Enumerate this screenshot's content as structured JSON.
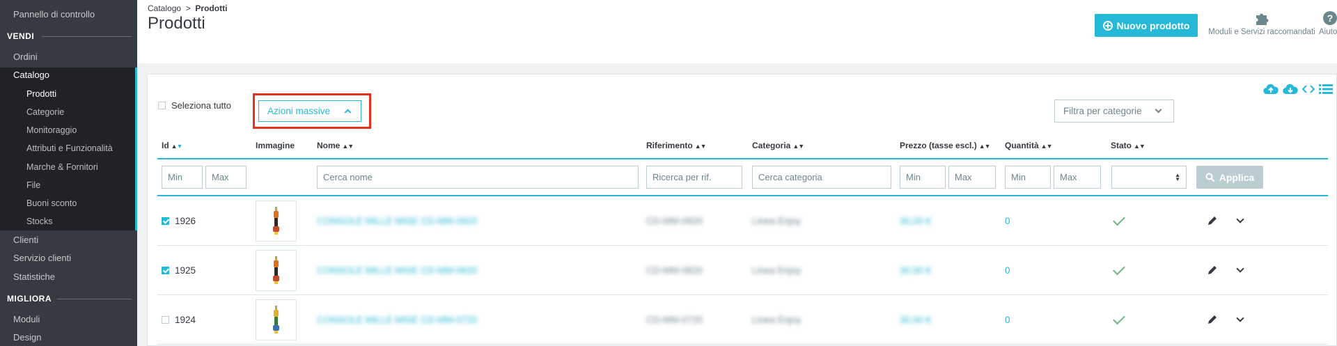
{
  "sidebar": {
    "dashboard": "Pannello di controllo",
    "section_sell": "VENDI",
    "orders": "Ordini",
    "catalog": "Catalogo",
    "catalog_sub": [
      "Prodotti",
      "Categorie",
      "Monitoraggio",
      "Attributi e Funzionalità",
      "Marche & Fornitori",
      "File",
      "Buoni sconto",
      "Stocks"
    ],
    "customers": "Clienti",
    "customer_service": "Servizio clienti",
    "stats": "Statistiche",
    "section_improve": "MIGLIORA",
    "modules": "Moduli",
    "design": "Design"
  },
  "header": {
    "breadcrumb_parent": "Catalogo",
    "breadcrumb_sep": ">",
    "breadcrumb_current": "Prodotti",
    "title": "Prodotti",
    "new_product": "Nuovo prodotto",
    "modules_link": "Moduli e Servizi raccomandati",
    "help_link": "Aiuto"
  },
  "toolbar": {
    "select_all": "Seleziona tutto",
    "bulk_actions": "Azioni massive",
    "filter_categories": "Filtra per categorie"
  },
  "table": {
    "headers": {
      "id": "Id",
      "image": "Immagine",
      "name": "Nome",
      "reference": "Riferimento",
      "category": "Categoria",
      "price": "Prezzo (tasse escl.)",
      "quantity": "Quantità",
      "status": "Stato"
    },
    "filters": {
      "id_min": "Min",
      "id_max": "Max",
      "name": "Cerca nome",
      "reference": "Ricerca per rif.",
      "category": "Cerca categoria",
      "price_min": "Min",
      "price_max": "Max",
      "qty_min": "Min",
      "qty_max": "Max",
      "apply": "Applica"
    },
    "rows": [
      {
        "id": "1926",
        "checked": true,
        "name": "CONSOLE MILLE MISE CD-MM-0920",
        "reference": "CD-MM-0920",
        "category": "Linea Enjoy",
        "price": "30,00 €",
        "quantity": "0"
      },
      {
        "id": "1925",
        "checked": true,
        "name": "CONSOLE MILLE MISE CD-MM-0820",
        "reference": "CD-MM-0820",
        "category": "Linea Enjoy",
        "price": "30,00 €",
        "quantity": "0"
      },
      {
        "id": "1924",
        "checked": false,
        "name": "CONSOLE MILLE MISE CD-MM-0720",
        "reference": "CD-MM-0720",
        "category": "Linea Enjoy",
        "price": "30,00 €",
        "quantity": "0"
      }
    ]
  },
  "colors": {
    "accent": "#25b9d7",
    "sidebar_bg": "#363a41",
    "highlight_box": "#e6301f",
    "status_ok": "#70b580"
  }
}
